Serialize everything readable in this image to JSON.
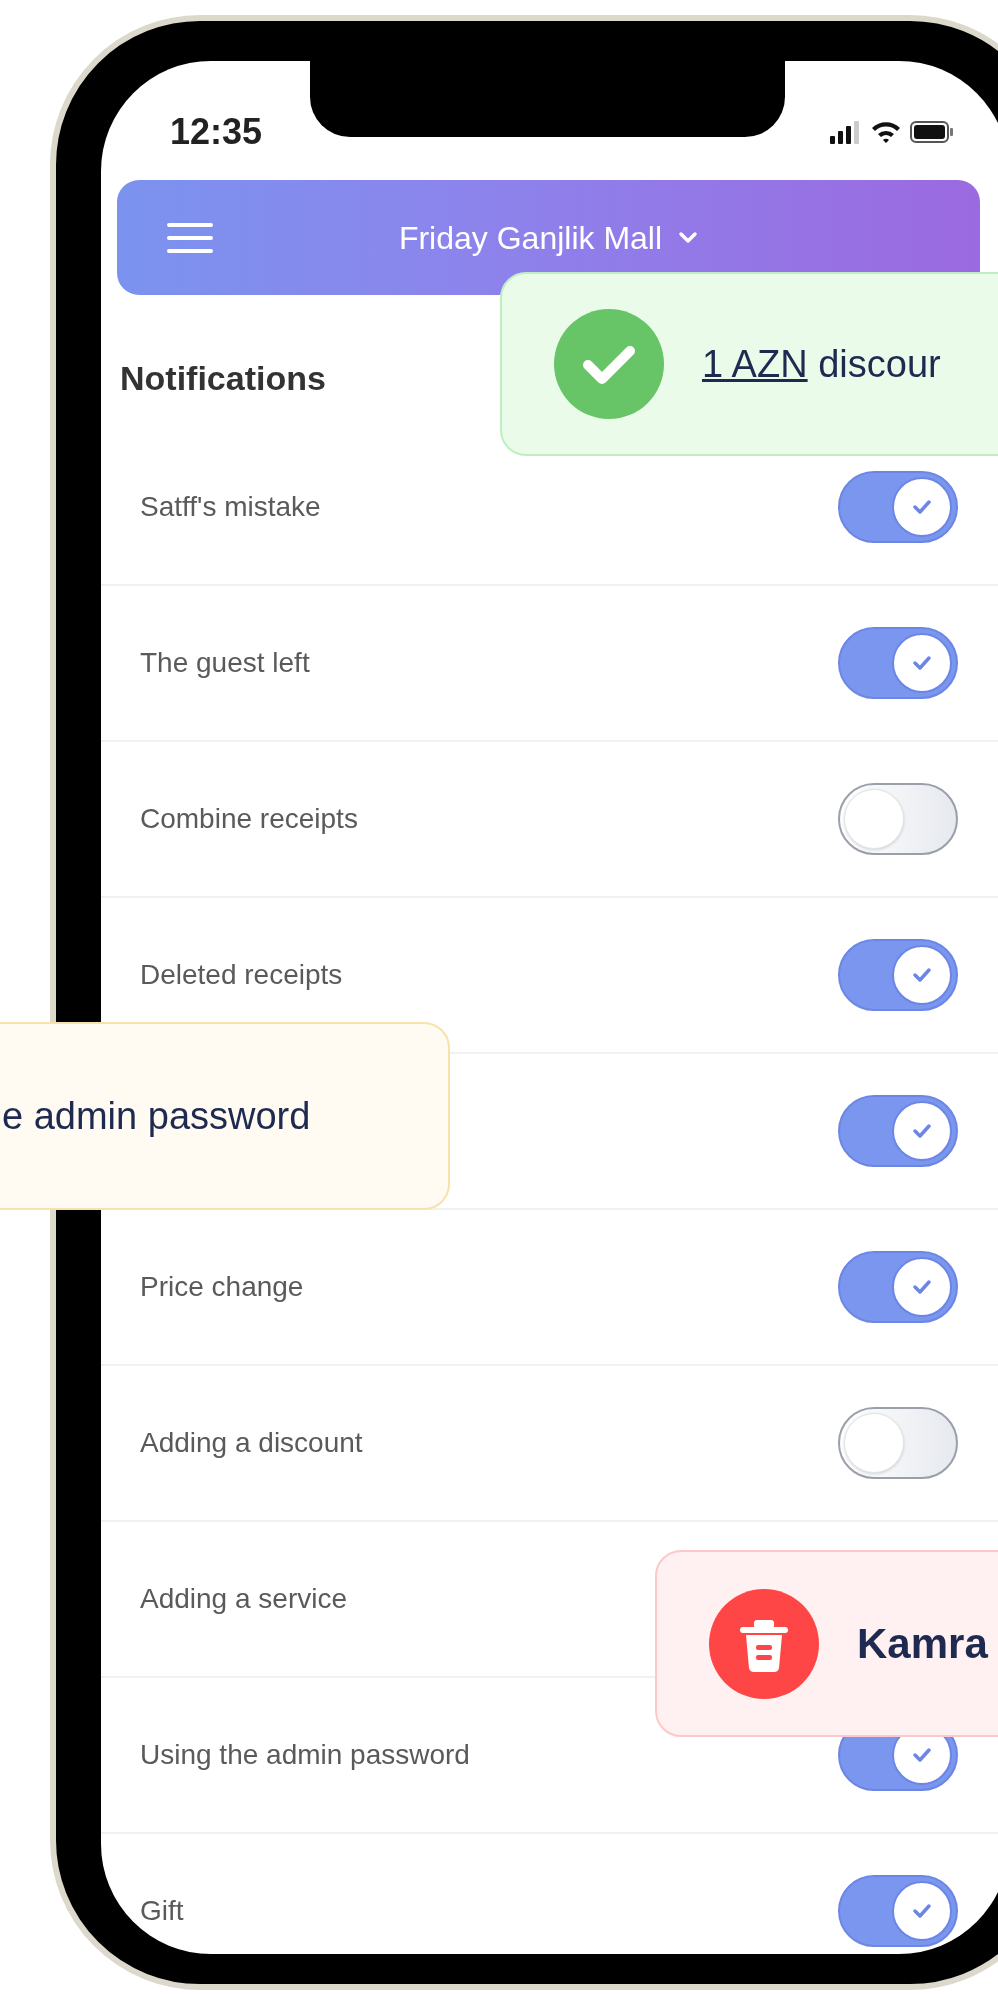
{
  "status_bar": {
    "time": "12:35"
  },
  "header": {
    "title": "Friday Ganjlik Mall"
  },
  "section_title": "Notifications",
  "settings": [
    {
      "label": "Satff's mistake",
      "on": true
    },
    {
      "label": "The guest left",
      "on": true
    },
    {
      "label": "Combine receipts",
      "on": false
    },
    {
      "label": "Deleted receipts",
      "on": true
    },
    {
      "on": true
    },
    {
      "label": "Price change",
      "on": true
    },
    {
      "label": "Adding a discount",
      "on": false
    },
    {
      "label": "Adding a service"
    },
    {
      "label": "Using the admin password",
      "on": true
    },
    {
      "label": "Gift",
      "on": true
    }
  ],
  "toasts": [
    {
      "kind": "success",
      "link": "1 AZN",
      "text": "discour"
    },
    {
      "kind": "warning",
      "text": "e admin password"
    },
    {
      "kind": "error",
      "text": "Kamra"
    }
  ]
}
